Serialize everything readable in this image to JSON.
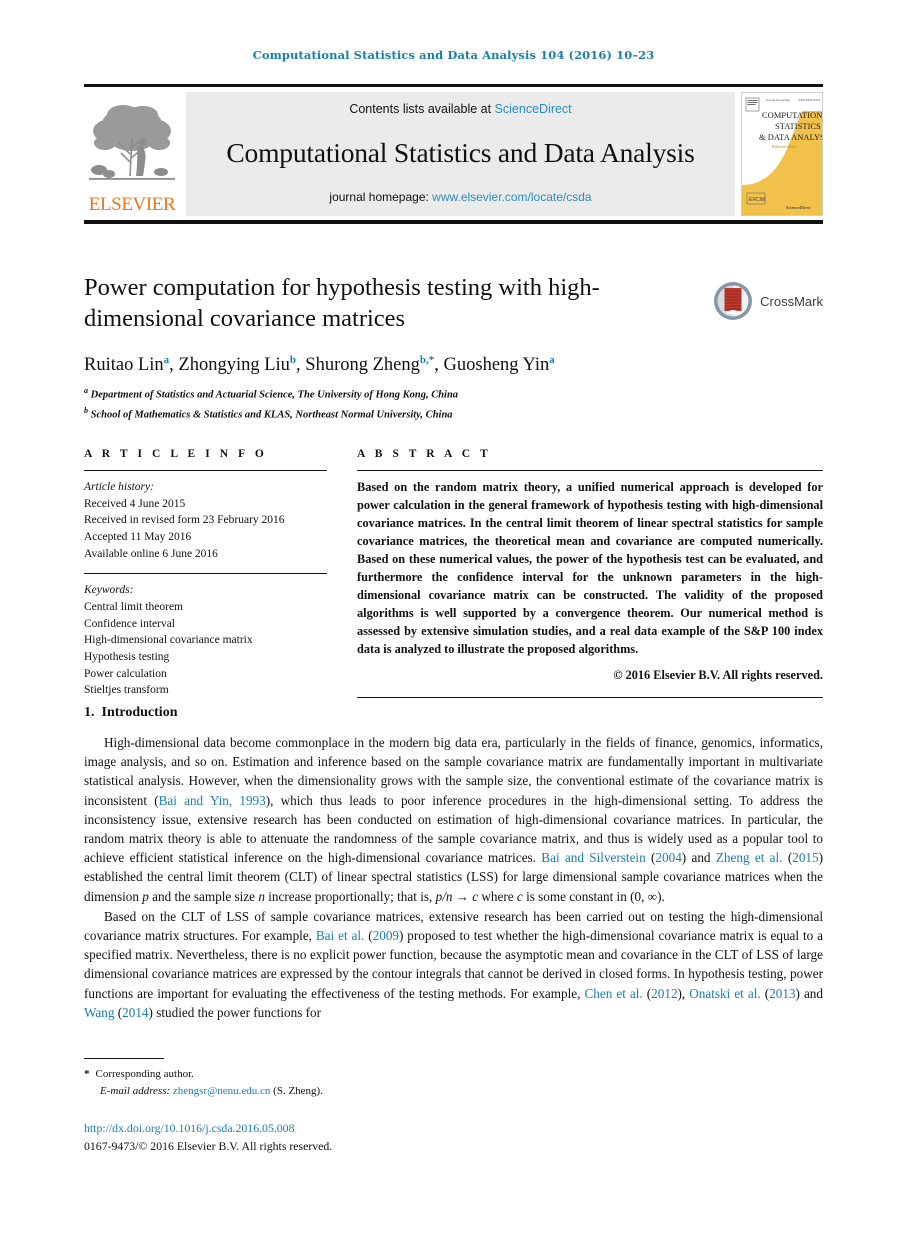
{
  "running_head": "Computational Statistics and Data Analysis 104 (2016) 10–23",
  "masthead": {
    "publisher_name": "ELSEVIER",
    "contents_prefix": "Contents lists available at ",
    "contents_link": "ScienceDirect",
    "journal_title": "Computational Statistics and Data Analysis",
    "homepage_prefix": "journal homepage: ",
    "homepage_link": "www.elsevier.com/locate/csda",
    "cover": {
      "line1": "COMPUTATIONAL",
      "line2": "STATISTICS",
      "line3": "& DATA ANALYSIS"
    }
  },
  "article": {
    "title": "Power computation for hypothesis testing with high-dimensional covariance matrices",
    "crossmark_label": "CrossMark",
    "authors": [
      {
        "name": "Ruitao Lin",
        "sup": "a",
        "sep": ", "
      },
      {
        "name": "Zhongying Liu",
        "sup": "b",
        "sep": ", "
      },
      {
        "name": "Shurong Zheng",
        "sup": "b,*",
        "sep": ", "
      },
      {
        "name": "Guosheng Yin",
        "sup": "a",
        "sep": ""
      }
    ],
    "affiliations": [
      {
        "label": "a",
        "text": "Department of Statistics and Actuarial Science, The University of Hong Kong, China"
      },
      {
        "label": "b",
        "text": "School of Mathematics & Statistics and KLAS, Northeast Normal University, China"
      }
    ]
  },
  "article_info": {
    "heading": "A R T I C L E   I N F O",
    "history_label": "Article history:",
    "history": [
      "Received 4 June 2015",
      "Received in revised form 23 February 2016",
      "Accepted 11 May 2016",
      "Available online 6 June 2016"
    ],
    "keywords_label": "Keywords:",
    "keywords": [
      "Central limit theorem",
      "Confidence interval",
      "High-dimensional covariance matrix",
      "Hypothesis testing",
      "Power calculation",
      "Stieltjes transform"
    ]
  },
  "abstract": {
    "heading": "A B S T R A C T",
    "text": "Based on the random matrix theory, a unified numerical approach is developed for power calculation in the general framework of hypothesis testing with high-dimensional covariance matrices. In the central limit theorem of linear spectral statistics for sample covariance matrices, the theoretical mean and covariance are computed numerically. Based on these numerical values, the power of the hypothesis test can be evaluated, and furthermore the confidence interval for the unknown parameters in the high-dimensional covariance matrix can be constructed. The validity of the proposed algorithms is well supported by a convergence theorem. Our numerical method is assessed by extensive simulation studies, and a real data example of the S&P 100 index data is analyzed to illustrate the proposed algorithms.",
    "copyright": "© 2016 Elsevier B.V. All rights reserved."
  },
  "body": {
    "section_number": "1.",
    "section_title": "Introduction",
    "paragraph_1": {
      "part1": "High-dimensional data become commonplace in the modern big data era, particularly in the fields of finance, genomics, informatics, image analysis, and so on. Estimation and inference based on the sample covariance matrix are fundamentally important in multivariate statistical analysis. However, when the dimensionality grows with the sample size, the conventional estimate of the covariance matrix is inconsistent (",
      "cite1": "Bai and Yin, 1993",
      "part2": "), which thus leads to poor inference procedures in the high-dimensional setting. To address the inconsistency issue, extensive research has been conducted on estimation of high-dimensional covariance matrices. In particular, the random matrix theory is able to attenuate the randomness of the sample covariance matrix, and thus is widely used as a popular tool to achieve efficient statistical inference on the high-dimensional covariance matrices. ",
      "cite2": "Bai and Silverstein",
      "part3": " (",
      "cite3": "2004",
      "part4": ") and ",
      "cite4": "Zheng et al.",
      "part5": " (",
      "cite5": "2015",
      "part6": ") established the central limit theorem (CLT) of linear spectral statistics (LSS) for large dimensional sample covariance matrices when the dimension ",
      "math1": "p",
      "part7": " and the sample size ",
      "math2": "n",
      "part8": " increase proportionally; that is, ",
      "math3": "p/n",
      "part9": " → ",
      "math4": "c",
      "part10": " where ",
      "math5": "c",
      "part11": " is some constant in (0, ∞)."
    },
    "paragraph_2": {
      "part1": "Based on the CLT of LSS of sample covariance matrices, extensive research has been carried out on testing the high-dimensional covariance matrix structures. For example, ",
      "cite1": "Bai et al.",
      "part2": " (",
      "cite2": "2009",
      "part3": ") proposed to test whether the high-dimensional covariance matrix is equal to a specified matrix. Nevertheless, there is no explicit power function, because the asymptotic mean and covariance in the CLT of LSS of large dimensional covariance matrices are expressed by the contour integrals that cannot be derived in closed forms. In hypothesis testing, power functions are important for evaluating the effectiveness of the testing methods. For example, ",
      "cite3": "Chen et al.",
      "part4": " (",
      "cite4": "2012",
      "part5": "), ",
      "cite5": "Onatski et al.",
      "part6": " (",
      "cite6": "2013",
      "part7": ") and ",
      "cite7": "Wang",
      "part8": " (",
      "cite8": "2014",
      "part9": ") studied the power functions for"
    }
  },
  "footer": {
    "star": "*",
    "corresponding": "Corresponding author.",
    "email_label": "E-mail address:",
    "email": "zhengsr@nenu.edu.cn",
    "email_suffix": "(S. Zheng).",
    "doi": "http://dx.doi.org/10.1016/j.csda.2016.05.008",
    "issn": "0167-9473/© 2016 Elsevier B.V. All rights reserved."
  },
  "colors": {
    "link": "#1a7fa8",
    "sciencedirect": "#2b8cbe",
    "elsevier_orange": "#e87722",
    "cover_yellow": "#f2c14b",
    "crossmark_red": "#c0392b"
  }
}
